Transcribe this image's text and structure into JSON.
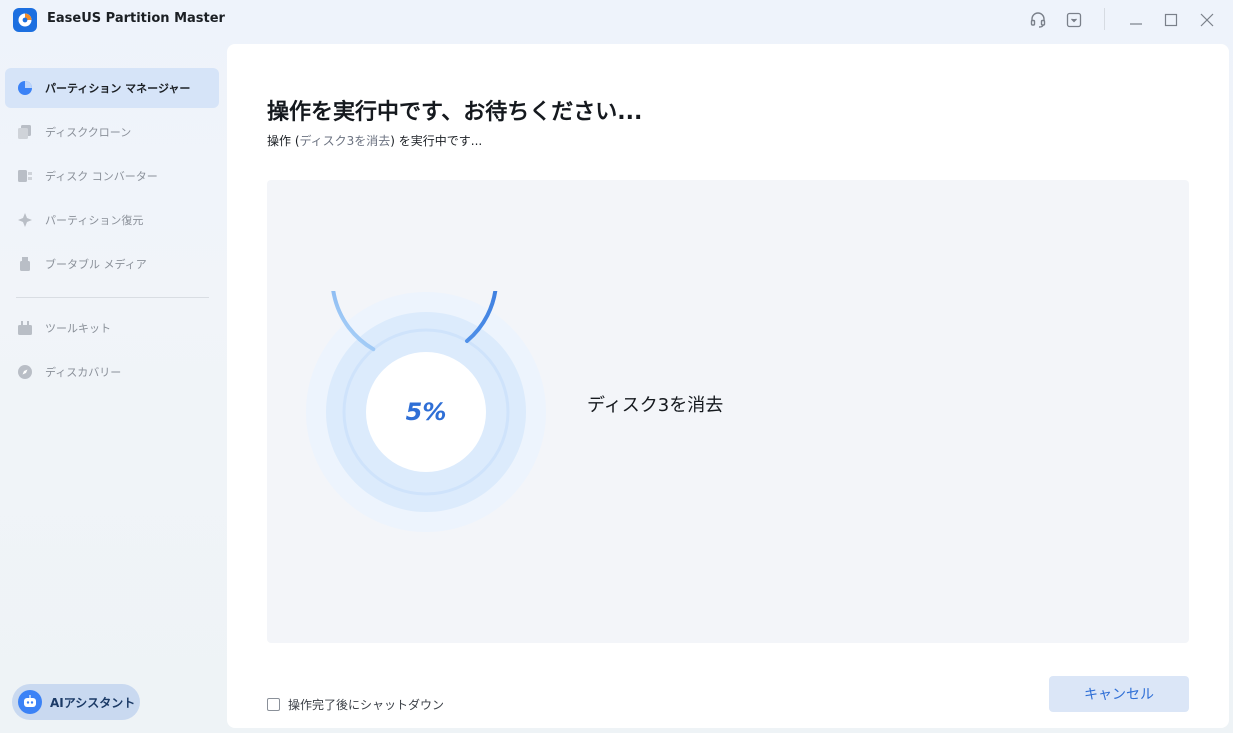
{
  "window": {
    "title": "EaseUS Partition Master",
    "controls": [
      "headset-icon",
      "dropdown-icon",
      "minimize-icon",
      "maximize-icon",
      "close-icon"
    ]
  },
  "sidebar": {
    "items": [
      {
        "label": "パーティション マネージャー",
        "icon": "pie-chart-icon",
        "active": true
      },
      {
        "label": "ディスククローン",
        "icon": "disk-clone-icon",
        "active": false
      },
      {
        "label": "ディスク コンバーター",
        "icon": "disk-convert-icon",
        "active": false
      },
      {
        "label": "パーティション復元",
        "icon": "recover-icon",
        "active": false
      },
      {
        "label": "ブータブル メディア",
        "icon": "usb-icon",
        "active": false
      },
      {
        "label": "ツールキット",
        "icon": "toolkit-icon",
        "active": false
      },
      {
        "label": "ディスカバリー",
        "icon": "compass-icon",
        "active": false
      }
    ],
    "ai_button": "AIアシスタント"
  },
  "main": {
    "heading": "操作を実行中です、お待ちください...",
    "subtitle_prefix": "操作 (",
    "subtitle_highlight": "ディスク3を消去",
    "subtitle_suffix": ") を実行中です...",
    "progress": {
      "value": 5,
      "label": "5%"
    },
    "task_label": "ディスク3を消去",
    "shutdown_checkbox": "操作完了後にシャットダウン",
    "shutdown_checked": false,
    "cancel_button": "キャンセル"
  },
  "colors": {
    "accent": "#2f6fd6",
    "active_nav_bg": "#d6e4f8",
    "cancel_bg": "#dbe6f7"
  }
}
